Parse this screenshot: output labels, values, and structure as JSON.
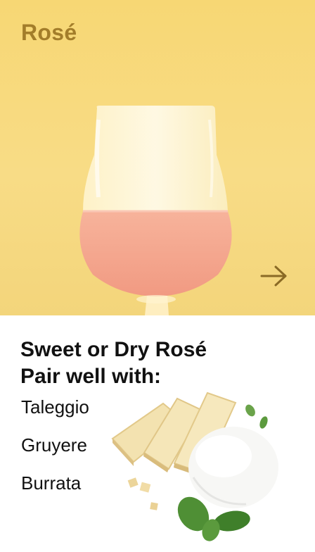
{
  "hero": {
    "title": "Rosé",
    "title_color": "#a37d2a",
    "next_icon": "arrow-right-icon",
    "glass_icon": "wine-glass-icon"
  },
  "pairing": {
    "heading_line1": "Sweet or Dry Rosé",
    "heading_line2": "Pair well with:",
    "cheeses": [
      "Taleggio",
      "Gruyere",
      "Burrata"
    ],
    "image_icon": "cheese-plate-icon"
  },
  "colors": {
    "background_top": "#f7d774",
    "wine": "#f3a98f",
    "text": "#111111"
  }
}
